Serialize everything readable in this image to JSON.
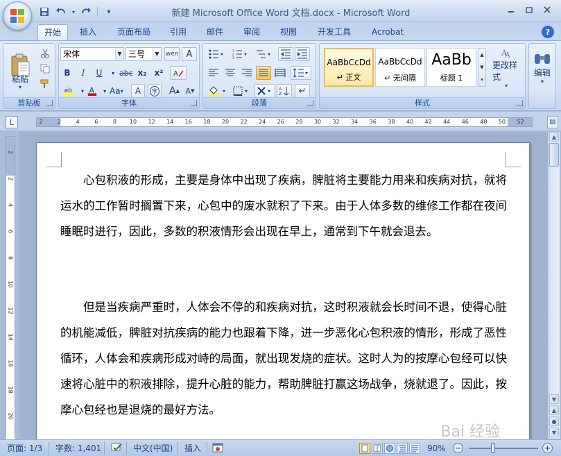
{
  "window": {
    "title": "新建 Microsoft Office Word 文档.docx - Microsoft Word"
  },
  "qat": {
    "save_icon": "save-icon",
    "undo_icon": "undo-icon",
    "redo_icon": "redo-icon",
    "customize_icon": "customize-qat-icon"
  },
  "tabs": [
    {
      "label": "开始",
      "active": true
    },
    {
      "label": "插入"
    },
    {
      "label": "页面布局"
    },
    {
      "label": "引用"
    },
    {
      "label": "邮件"
    },
    {
      "label": "审阅"
    },
    {
      "label": "视图"
    },
    {
      "label": "开发工具"
    },
    {
      "label": "Acrobat"
    }
  ],
  "clipboard": {
    "paste_label": "粘贴",
    "group_label": "剪贴板"
  },
  "font": {
    "font_name": "宋体",
    "font_size": "三号",
    "wen_label": "wén",
    "group_label": "字体",
    "bold": "B",
    "italic": "I",
    "underline": "U",
    "strike": "abc",
    "subscript": "x₂",
    "superscript": "x²",
    "change_case": "Aa",
    "grow": "A",
    "shrink": "A"
  },
  "paragraph": {
    "group_label": "段落"
  },
  "styles": {
    "group_label": "样式",
    "items": [
      {
        "sample": "AaBbCcDd",
        "name": "↵ 正文",
        "selected": true
      },
      {
        "sample": "AaBbCcDd",
        "name": "↵ 无间隔"
      },
      {
        "sample": "AaBb",
        "name": "标题 1"
      }
    ],
    "change_styles_label": "更改样式"
  },
  "editing": {
    "label": "编辑"
  },
  "ruler": {
    "ticks": [
      "2",
      "2",
      "4",
      "6",
      "8",
      "10",
      "12",
      "14",
      "16",
      "18",
      "20",
      "22",
      "24",
      "26",
      "28",
      "30",
      "32",
      "34",
      "36",
      "38",
      "40",
      "42",
      "44",
      "46",
      "48",
      "50",
      "52"
    ],
    "vticks": [
      "2",
      "2",
      "4",
      "6",
      "8",
      "10",
      "12",
      "14",
      "16",
      "18",
      "20"
    ]
  },
  "document": {
    "paragraphs": [
      "心包积液的形成，主要是身体中出现了疾病，脾脏将主要能力用来和疾病对抗，就将运水的工作暂时搁置下来，心包中的废水就积了下来。由于人体多数的维修工作都在夜间睡眠时进行，因此，多数的积液情形会出现在早上，通常到下午就会退去。",
      "但是当疾病严重时，人体会不停的和疾病对抗，这时积液就会长时间不退，使得心脏的机能减低，脾脏对抗疾病的能力也跟着下降，进一步恶化心包积液的情形，形成了恶性循环，人体会和疾病形成对峙的局面，就出现发烧的症状。这时人为的按摩心包经可以快速将心脏中的积液排除，提升心脏的能力，帮助脾脏打赢这场战争，烧就退了。因此，按摩心包经也是退烧的最好方法。"
    ],
    "watermark": "Bai 经验"
  },
  "status": {
    "page": "页面: 1/3",
    "words": "字数: 1,401",
    "language": "中文(中国)",
    "insert_mode": "插入",
    "zoom": "90%",
    "zoom_minus": "−",
    "zoom_plus": "+"
  }
}
